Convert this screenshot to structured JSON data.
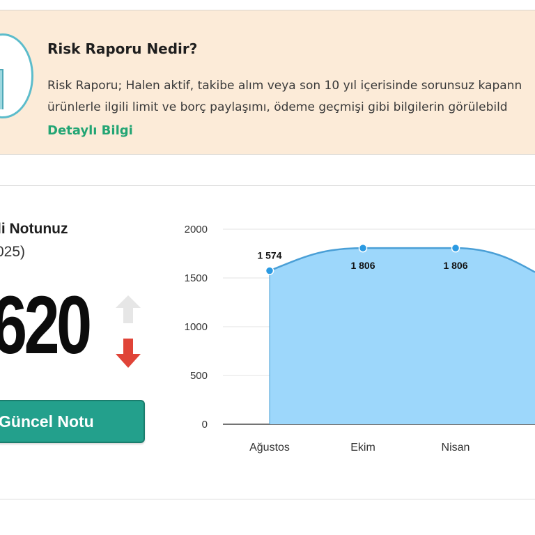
{
  "info_banner": {
    "title": "Risk Raporu Nedir?",
    "text_line_1": "Risk Raporu; Halen aktif, takibe alım veya son 10 yıl içerisinde sorunsuz kapann",
    "text_line_2": "ürünlerle ilgili limit ve borç paylaşımı, ödeme geçmişi gibi bilgilerin görülebild",
    "link_label": "Detaylı Bilgi",
    "icon": "document-icon"
  },
  "score_panel": {
    "title": "li Notunuz",
    "period": "025)",
    "score": "620",
    "trend_up_icon": "arrow-up-icon",
    "trend_down_icon": "arrow-down-icon",
    "button_label": "Güncel Notu"
  },
  "colors": {
    "banner_bg": "#fcebd8",
    "link": "#23a574",
    "button": "#23a08c",
    "area_fill": "#9dd7fb",
    "line": "#4a9fd6",
    "marker": "#2b9ae2",
    "trend_down": "#e04438",
    "trend_up": "#e6e6e6"
  },
  "chart_data": {
    "type": "area",
    "categories": [
      "Ağustos",
      "Ekim",
      "Nisan"
    ],
    "values": [
      1574,
      1806,
      1806
    ],
    "data_labels": [
      "1 574",
      "1 806",
      "1 806"
    ],
    "y_ticks": [
      "0",
      "500",
      "1000",
      "1500",
      "2000"
    ],
    "ylim": [
      0,
      2000
    ],
    "grid": true,
    "title": "",
    "xlabel": "",
    "ylabel": ""
  }
}
